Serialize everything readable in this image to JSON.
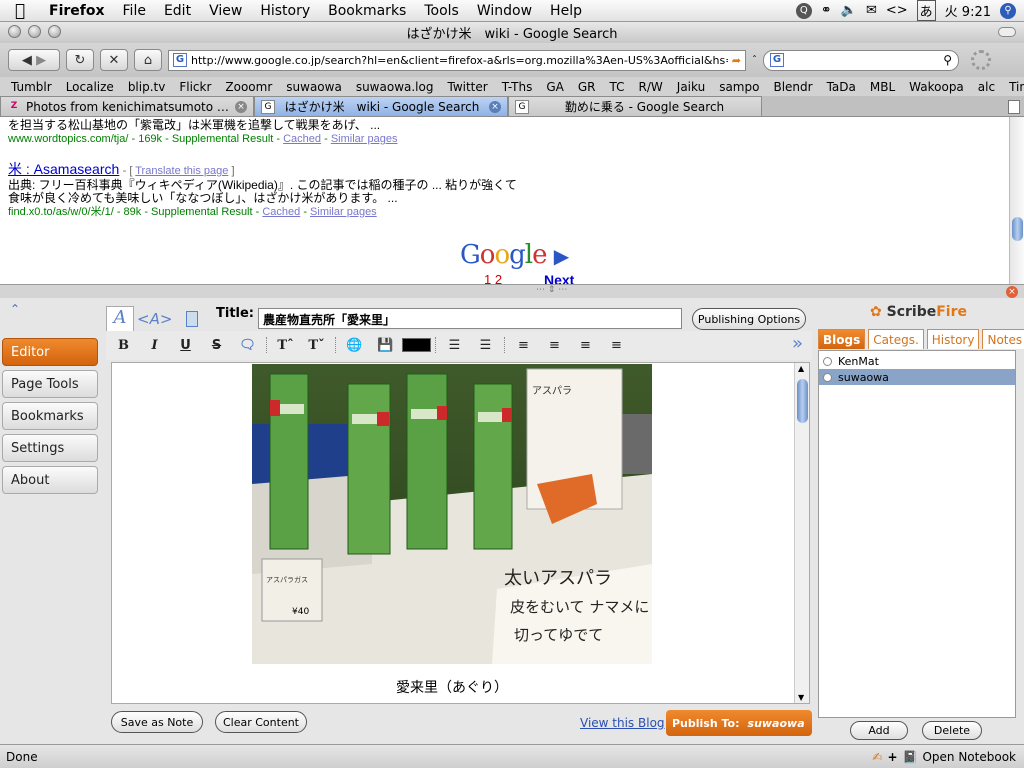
{
  "menubar": {
    "app": "Firefox",
    "items": [
      "File",
      "Edit",
      "View",
      "History",
      "Bookmarks",
      "Tools",
      "Window",
      "Help"
    ],
    "clock": "火 9:21",
    "input_mode": "あ"
  },
  "window": {
    "title": "はざかけ米　wiki - Google Search"
  },
  "nav": {
    "url": "http://www.google.co.jp/search?hl=en&client=firefox-a&rls=org.mozilla%3Aen-US%3Aofficial&hs=",
    "search_value": ""
  },
  "bookmarks": [
    "Tumblr",
    "Localize",
    "blip.tv",
    "Flickr",
    "Zooomr",
    "suwaowa",
    "suwaowa.log",
    "Twitter",
    "T-Ths",
    "GA",
    "GR",
    "TC",
    "R/W",
    "Jaiku",
    "sampo",
    "Blendr",
    "TaDa",
    "MBL",
    "Wakoopa",
    "alc",
    "Tiny"
  ],
  "tabs": [
    {
      "label": "Photos from kenichimatsumoto | Zoo...",
      "fav": "Z"
    },
    {
      "label": "はざかけ米　wiki - Google Search",
      "fav": "G"
    },
    {
      "label": "勤めに乗る - Google Search",
      "fav": "G"
    }
  ],
  "results": {
    "r1_snippet": "を担当する松山基地の「紫電改」は米軍機を追撃して戦果をあげ、 ...",
    "r1_url": "www.wordtopics.com/tja/ - 169k - Supplemental Result - ",
    "cached": "Cached",
    "similar": "Similar pages",
    "r2_title": "米 : Asamasearch",
    "r2_translate": "Translate this page",
    "r2_snip1": "出典: フリー百科事典『ウィキペディア(Wikipedia)』. この記事では稲の種子の ... 粘りが強くて",
    "r2_snip2": "食味が良く冷めても美味しい「ななつぼし」、はざかけ米があります。 ...",
    "r2_url": "find.x0.to/as/w/0/米/1/ - 89k - Supplemental Result - ",
    "pager_pages": "1 2",
    "pager_next": "Next",
    "logo": "Google"
  },
  "scribefire": {
    "brand_scribe": "Scribe",
    "brand_fire": "Fire",
    "nav": [
      "Editor",
      "Page Tools",
      "Bookmarks",
      "Settings",
      "About"
    ],
    "title_label": "Title:",
    "title_value": "農産物直売所「愛来里」",
    "publishing_options": "Publishing Options",
    "caption": "愛来里（あぐり）",
    "save_as_note": "Save as Note",
    "clear_content": "Clear Content",
    "view_blog": "View this Blog",
    "publish_to_label": "Publish To:",
    "publish_to_blog": "suwaowa",
    "right_tabs": [
      "Blogs",
      "Categs.",
      "History",
      "Notes"
    ],
    "blogs": [
      "KenMat",
      "suwaowa"
    ],
    "add": "Add",
    "delete": "Delete",
    "photo_labels": {
      "tag1": "アスパラ",
      "tag2": "アスパラガス",
      "price": "¥40",
      "handwriting1": "太いアスパラ",
      "handwriting2": "皮をむいて ナマメに",
      "handwriting3": "切ってゆでて"
    }
  },
  "status": {
    "left": "Done",
    "open_notebook": "Open Notebook"
  }
}
